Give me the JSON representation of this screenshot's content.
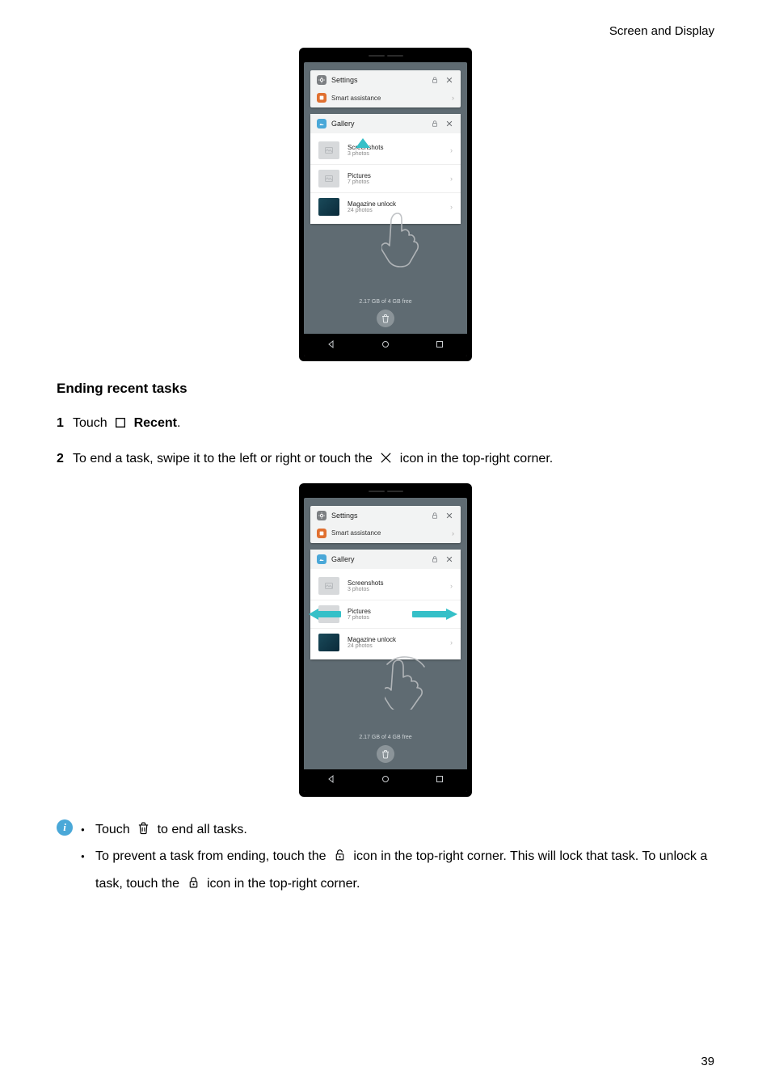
{
  "header": {
    "section_label": "Screen and Display"
  },
  "section": {
    "title": "Ending recent tasks"
  },
  "steps": {
    "step1_prefix": "Touch ",
    "step1_bold": "Recent",
    "step1_suffix": ".",
    "step2_prefix": "To end a task, swipe it to the left or right or touch the ",
    "step2_suffix": " icon in the top-right corner."
  },
  "tips": {
    "tip1_prefix": "Touch ",
    "tip1_suffix": " to end all tasks.",
    "tip2_part1": "To prevent a task from ending, touch the ",
    "tip2_part2": " icon in the top-right corner. This will lock that task. To unlock a task, touch the ",
    "tip2_part3": " icon in the top-right corner."
  },
  "phone": {
    "apps": {
      "settings": {
        "title": "Settings",
        "sub_title": "Smart assistance"
      },
      "gallery": {
        "title": "Gallery",
        "albums": [
          {
            "name": "Screenshots",
            "count": "3 photos"
          },
          {
            "name": "Pictures",
            "count": "7 photos"
          },
          {
            "name": "Magazine unlock",
            "count": "24 photos"
          }
        ]
      }
    },
    "storage": "2.17 GB of 4 GB free"
  },
  "phone2": {
    "apps": {
      "settings": {
        "title": "Settings",
        "sub_title": "Smart assistance"
      },
      "gallery": {
        "title": "Gallery",
        "albums": [
          {
            "name": "Screenshots",
            "count": "3 photos"
          },
          {
            "name": "Pictures",
            "count": "7 photos"
          },
          {
            "name": "Magazine unlock",
            "count": "24 photos"
          }
        ]
      }
    },
    "storage": "2.17 GB of 4 GB free"
  },
  "page_number": "39"
}
